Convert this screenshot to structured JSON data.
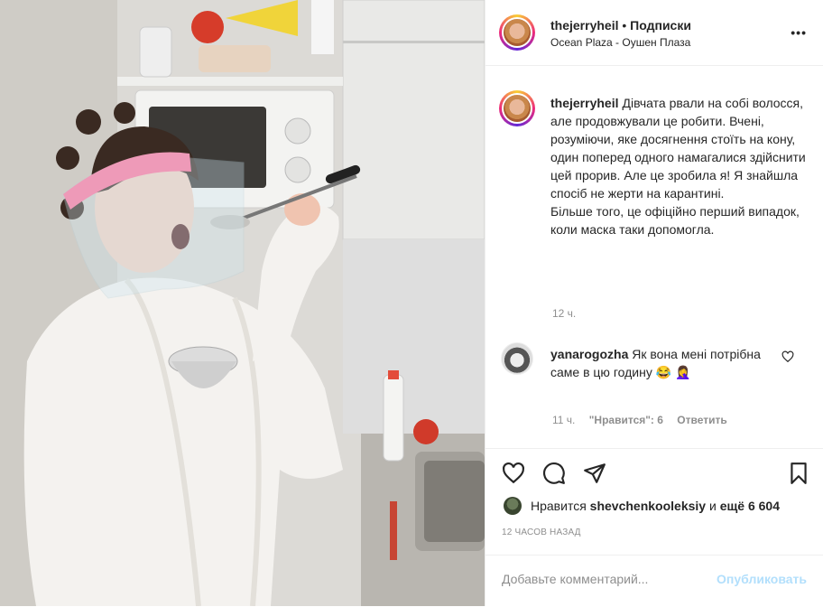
{
  "header": {
    "username": "thejerryheil",
    "separator": " • ",
    "follow_label": "Подписки",
    "location": "Ocean Plaza - Оушен Плаза",
    "more_label": "•••"
  },
  "caption": {
    "username": "thejerryheil",
    "text": "Дівчата рвали на собі волосся, але продовжували це робити. Вчені, розуміючи, яке досягнення стоїть на кону, один поперед одного намагалися здійснити цей прорив. Але це зробила я! Я знайшла спосіб не жерти на карантині.\nБільше того, це офіційно перший випадок, коли маска таки допомогла.",
    "time": "12 ч."
  },
  "comment": {
    "username": "yanarogozha",
    "text": "Як вона мені потрібна саме в цю годину 😂 🤦‍♀️",
    "time": "11 ч.",
    "likes": "\"Нравится\": 6",
    "reply_label": "Ответить"
  },
  "likes": {
    "prefix": "Нравится",
    "user": "shevchenkooleksiy",
    "joiner": " и ",
    "others": "ещё 6 604"
  },
  "time_ago": "12 ЧАСОВ НАЗАД",
  "add_comment": {
    "placeholder": "Добавьте комментарий...",
    "post_label": "Опубликовать"
  },
  "icons": [
    "heart-icon",
    "comment-icon",
    "share-icon",
    "bookmark-icon",
    "more-icon"
  ],
  "colors": {
    "accent": "#0095f6",
    "post_disabled": "#b2dffc",
    "muted": "#8e8e8e",
    "border": "#efefef"
  }
}
